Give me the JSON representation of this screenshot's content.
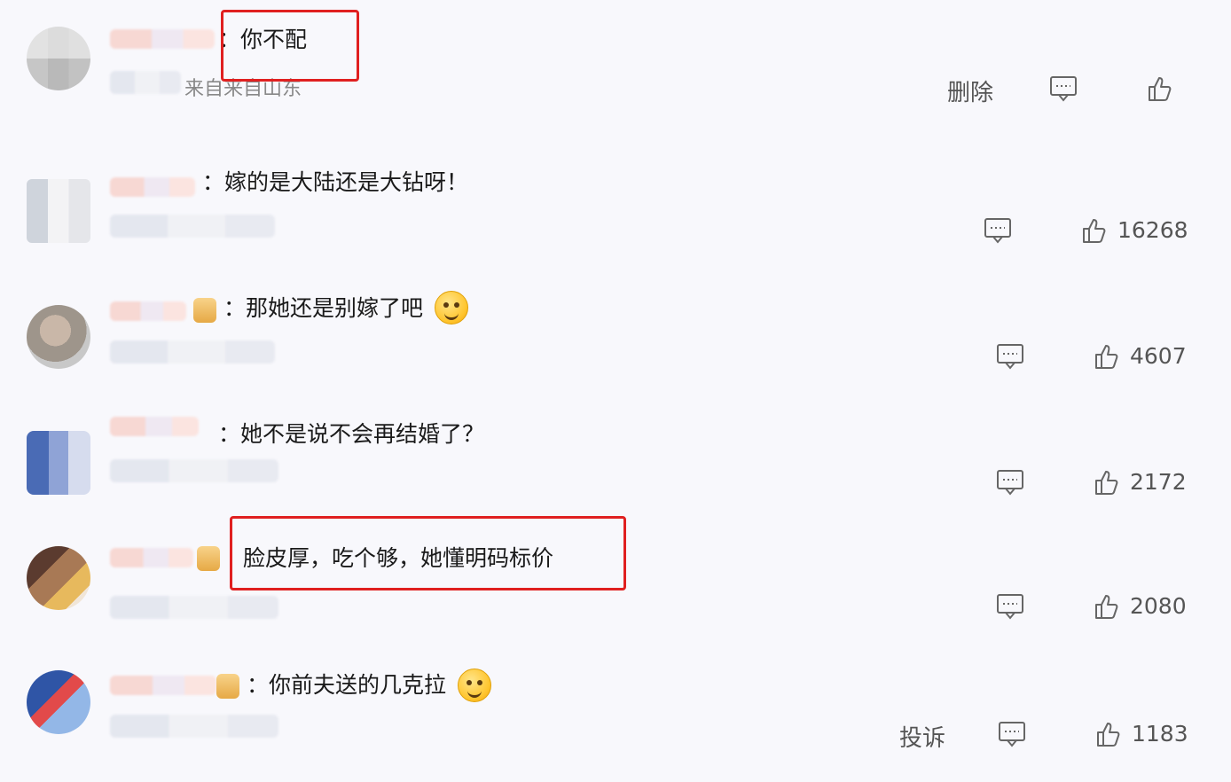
{
  "comments": [
    {
      "text": "：你不配",
      "location": "来自来自山东",
      "actions": {
        "delete": "删除",
        "likes": ""
      }
    },
    {
      "text": "：嫁的是大陆还是大钻呀！",
      "actions": {
        "likes": "16268"
      }
    },
    {
      "text": "：那她还是别嫁了吧",
      "actions": {
        "likes": "4607"
      }
    },
    {
      "text": "：她不是说不会再结婚了？",
      "actions": {
        "likes": "2172"
      }
    },
    {
      "text": "脸皮厚，吃个够，她懂明码标价",
      "actions": {
        "likes": "2080"
      }
    },
    {
      "text": "：你前夫送的几克拉",
      "actions": {
        "report": "投诉",
        "likes": "1183"
      }
    }
  ],
  "colors": {
    "highlight": "#e02020",
    "background": "#f8f8fc",
    "action": "#555555"
  },
  "icons": [
    "comment-icon",
    "thumbs-up-icon",
    "smile-emoji-icon",
    "sweat-emoji-icon",
    "member-badge-icon"
  ]
}
